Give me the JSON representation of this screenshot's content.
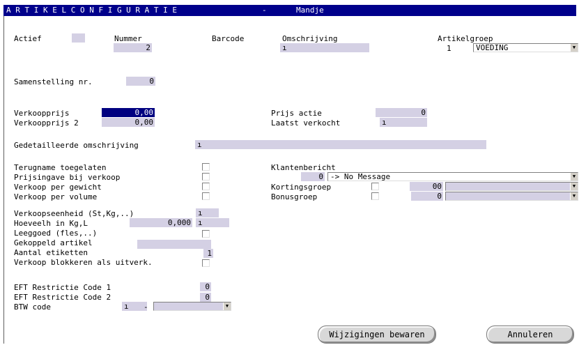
{
  "window": {
    "title": "A R T I K E L    C O N F I G U R A T I E",
    "separator": "-",
    "subtitle": "Mandje"
  },
  "header": {
    "actief_label": "Actief",
    "nummer_label": "Nummer",
    "nummer_value": "2",
    "barcode_label": "Barcode",
    "omschrijving_label": "Omschrijving",
    "omschrijving_value": "ı",
    "artikelgroep_label": "Artikelgroep",
    "artikelgroep_code": "1",
    "artikelgroep_value": "VOEDING"
  },
  "samenstelling": {
    "label": "Samenstelling nr.",
    "value": "0"
  },
  "prices": {
    "verkoopprijs_label": "Verkoopprijs",
    "verkoopprijs_value": "0,00",
    "verkoopprijs2_label": "Verkoopprijs 2",
    "verkoopprijs2_value": "0,00",
    "prijs_actie_label": "Prijs actie",
    "prijs_actie_value": "0",
    "laatst_verkocht_label": "Laatst verkocht",
    "laatst_verkocht_value": "ı"
  },
  "detail": {
    "label": "Gedetailleerde omschrijving",
    "value": "ı"
  },
  "options": {
    "terugname": "Terugname toegelaten",
    "prijsingave": "Prijsingave bij verkoop",
    "verkoop_gewicht": "Verkoop per gewicht",
    "verkoop_volume": "Verkoop per volume",
    "verkoopseenheid_label": "Verkoopseenheid (St,Kg,..)",
    "verkoopseenheid_value": "ı",
    "hoeveelheid_label": "Hoeveelh in Kg,L",
    "hoeveelheid_value": "0,000",
    "hoeveelheid_unit": "ı",
    "leeggoed": "Leeggoed (fles,..)",
    "gekoppeld": "Gekoppeld artikel",
    "aantal_etiketten_label": "Aantal etiketten",
    "aantal_etiketten_value": "1",
    "blokkeren": "Verkoop blokkeren als uitverk."
  },
  "right": {
    "klantenbericht_label": "Klantenbericht",
    "klantenbericht_code": "0",
    "klantenbericht_value": "-> No Message",
    "kortingsgroep_label": "Kortingsgroep",
    "kortingsgroep_code": "00",
    "bonusgroep_label": "Bonusgroep",
    "bonusgroep_code": "0"
  },
  "eft": {
    "code1_label": "EFT Restrictie Code 1",
    "code1_value": "0",
    "code2_label": "EFT Restrictie Code 2",
    "code2_value": "0",
    "btw_label": "BTW code",
    "btw_value": "ı",
    "btw_dash": "-"
  },
  "buttons": {
    "save": "Wijzigingen bewaren",
    "cancel": "Annuleren"
  }
}
